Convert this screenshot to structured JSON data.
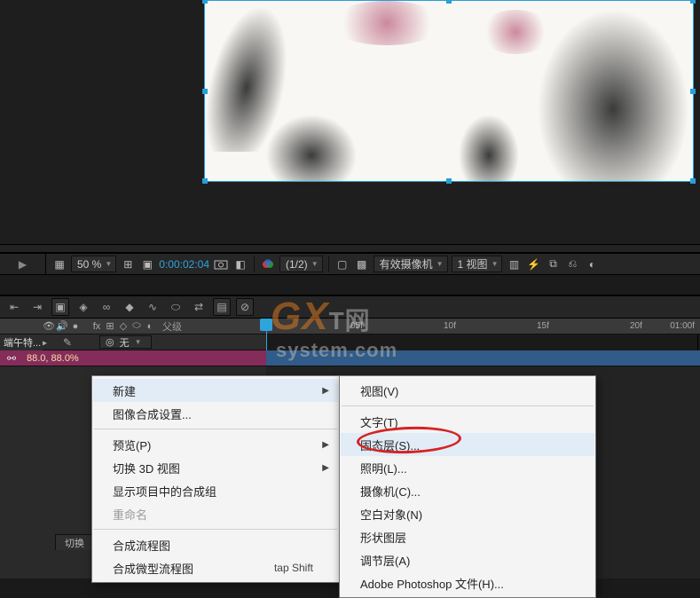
{
  "viewer_bar": {
    "zoom": "50 %",
    "timecode": "0:00:02:04",
    "res": "(1/2)",
    "camera": "有效摄像机",
    "view": "1 视图"
  },
  "timeline": {
    "parent_label": "父级",
    "none": "无",
    "comp_name": "端午特...",
    "scale_text": "88.0, 88.0%",
    "ticks": [
      "05f",
      "10f",
      "15f",
      "20f",
      "01:00f"
    ],
    "bottom_tab": "切换"
  },
  "menu": {
    "new": "新建",
    "comp_settings": "图像合成设置...",
    "preview": "预览(P)",
    "toggle_3d": "切换 3D 视图",
    "show_in_project": "显示项目中的合成组",
    "rename": "重命名",
    "flowchart": "合成流程图",
    "mini_flowchart": "合成微型流程图",
    "mini_flowchart_accel": "tap Shift",
    "sub": {
      "view": "视图(V)",
      "text": "文字(T)",
      "solid": "固态层(S)...",
      "light": "照明(L)...",
      "camera": "摄像机(C)...",
      "null": "空白对象(N)",
      "shape": "形状图层",
      "adjustment": "调节层(A)",
      "photoshop": "Adobe Photoshop 文件(H)..."
    }
  },
  "watermark": {
    "logo": "GX",
    "rest": "system.com",
    "mid": "T网"
  }
}
